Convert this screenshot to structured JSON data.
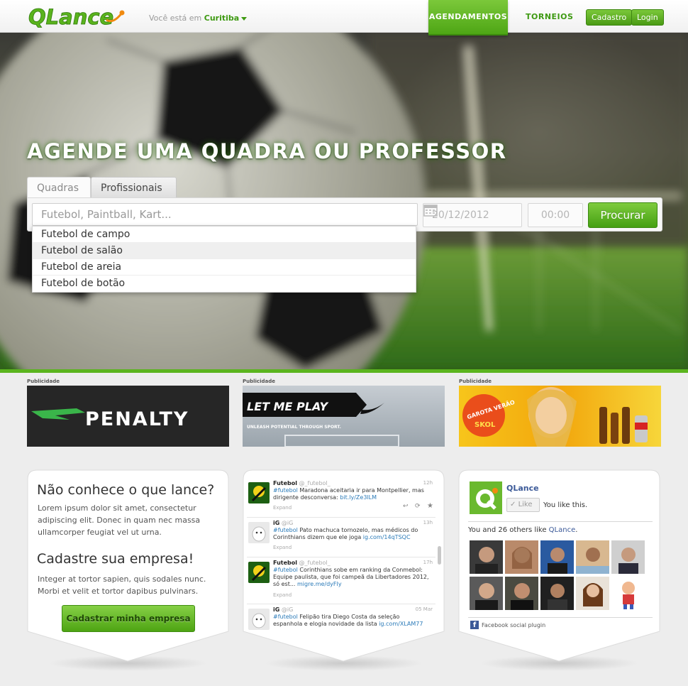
{
  "header": {
    "logo_text": "QLance",
    "location_prefix": "Você está em",
    "location_city": "Curitiba",
    "nav_active": "AGENDAMENTOS",
    "nav_link": "TORNEIOS",
    "signup": "Cadastro",
    "login": "Login"
  },
  "hero": {
    "title": "AGENDE UMA QUADRA OU PROFESSOR",
    "tabs": [
      "Quadras",
      "Profissionais"
    ],
    "search_placeholder": "Futebol, Paintball, Kart...",
    "date_value": "20/12/2012",
    "time_value": "00:00",
    "search_button": "Procurar",
    "suggestions": [
      "Futebol de campo",
      "Futebol de salão",
      "Futebol de areia",
      "Futebol de botão"
    ]
  },
  "ads": {
    "label": "Publicidade",
    "penalty_text": "PENALTY",
    "nike_headline": "LET ME PLAY",
    "nike_sub": "UNLEASH POTENTIAL THROUGH SPORT.",
    "skol_text": "GAROTA VERÃO",
    "skol_brand": "SKOL"
  },
  "about": {
    "heading1": "Não conhece o que lance?",
    "text1": "Lorem ipsum dolor sit amet, consectetur adipiscing elit. Donec in quam nec massa ullamcorper feugiat vel ut urna.",
    "heading2": "Cadastre sua empresa!",
    "text2": "Integer at tortor sapien, quis sodales nunc. Morbi et velit et tortor dapibus pulvinars.",
    "button": "Cadastrar minha empresa"
  },
  "twitter": {
    "tweets": [
      {
        "name": "Futebol",
        "handle": "@_futebol_",
        "time": "12h",
        "tag": "#futebol",
        "text": " Maradona aceitaria ir para Montpellier, mas dirigente desconversa: ",
        "link": "bit.ly/Ze3lLM",
        "expand": "Expand"
      },
      {
        "name": "iG",
        "handle": "@iG",
        "time": "13h",
        "tag": "#futebol",
        "text": " Pato machuca tornozelo, mas médicos do Corinthians dizem que ele joga ",
        "link": "ig.com/14qTSQC",
        "expand": "Expand"
      },
      {
        "name": "Futebol",
        "handle": "@_futebol_",
        "time": "17h",
        "tag": "#futebol",
        "text": " Corinthians sobe em ranking da Conmebol: Equipe paulista, que foi campeã da Libertadores 2012, só est... ",
        "link": "migre.me/dyFIy",
        "expand": "Expand"
      },
      {
        "name": "iG",
        "handle": "@iG",
        "time": "05 Mar",
        "tag": "#futebol",
        "text": " Felipão tira Diego Costa da seleção espanhola e elogia novidade da lista ",
        "link": "ig.com/XLAM77",
        "expand": ""
      }
    ]
  },
  "facebook": {
    "page_name": "QLance",
    "like_label": "Like",
    "you_like": "You like this.",
    "count_prefix": "You and 26 others like ",
    "count_link": "QLance",
    "count_suffix": ".",
    "plugin_label": "Facebook social plugin"
  },
  "colors": {
    "brand_green": "#5bb41e",
    "link_blue": "#3b5998"
  }
}
